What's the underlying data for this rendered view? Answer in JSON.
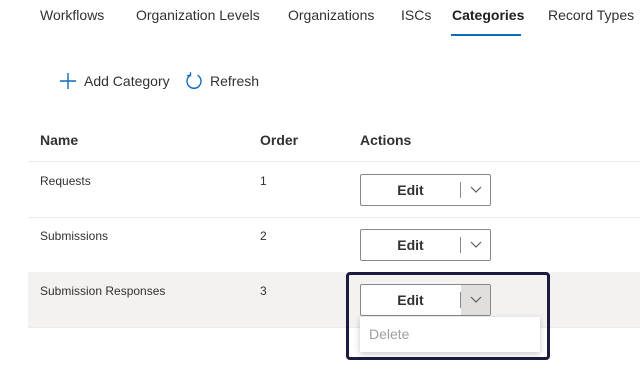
{
  "tabs": [
    {
      "label": "Workflows",
      "active": false
    },
    {
      "label": "Organization Levels",
      "active": false
    },
    {
      "label": "Organizations",
      "active": false
    },
    {
      "label": "ISCs",
      "active": false
    },
    {
      "label": "Categories",
      "active": true
    },
    {
      "label": "Record Types",
      "active": false
    }
  ],
  "commands": {
    "add_label": "Add Category",
    "add_icon": "add-icon",
    "refresh_label": "Refresh",
    "refresh_icon": "refresh-icon"
  },
  "table": {
    "columns": [
      "Name",
      "Order",
      "Actions"
    ],
    "rows": [
      {
        "name": "Requests",
        "order": "1",
        "action_label": "Edit"
      },
      {
        "name": "Submissions",
        "order": "2",
        "action_label": "Edit"
      },
      {
        "name": "Submission Responses",
        "order": "3",
        "action_label": "Edit"
      }
    ]
  },
  "dropdown": {
    "items": [
      {
        "label": "Delete",
        "disabled": true
      }
    ]
  },
  "colors": {
    "accent": "#0f6cbd",
    "focus_outline": "#1b1a3f",
    "row_highlight": "#f3f2f1",
    "disabled_text": "#a19f9d"
  }
}
